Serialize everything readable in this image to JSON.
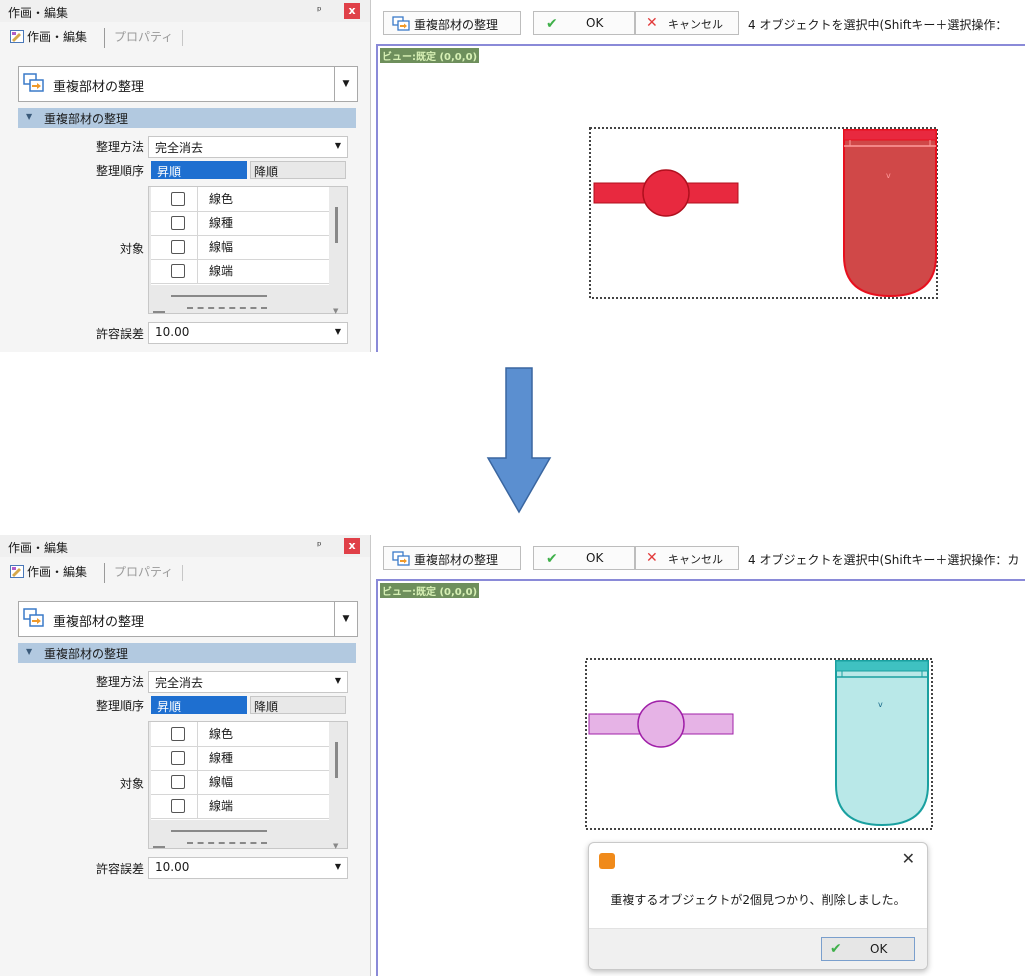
{
  "panel": {
    "title": "作画・編集",
    "pin": "ᵖ",
    "close": "x",
    "tab_active": "作画・編集",
    "tab_inactive": "プロパティ",
    "function_name": "重複部材の整理",
    "group_label": "重複部材の整理",
    "method_label": "整理方法",
    "method_value": "完全消去",
    "order_label": "整理順序",
    "order_asc": "昇順",
    "order_desc": "降順",
    "target_label": "対象",
    "targets": [
      "線色",
      "線種",
      "線幅",
      "線端"
    ],
    "tolerance_label": "許容誤差",
    "tolerance_value": "10.00"
  },
  "toolbar": {
    "function_button": "重複部材の整理",
    "ok_button": "OK",
    "cancel_button": "キャンセル",
    "status_top": "4 オブジェクトを選択中(Shiftキー＋選択操作：",
    "status_bottom": "4 オブジェクトを選択中(Shiftキー＋選択操作：カ"
  },
  "canvas": {
    "view_label": "ビュー:既定 (0,0,0)"
  },
  "dialog": {
    "message": "重複するオブジェクトが2個見つかり、削除しました。",
    "ok_button": "OK",
    "close": "✕"
  },
  "colors": {
    "selected_red": "#e8293f",
    "result_magenta": "#e6b3e6",
    "result_cyan": "#b9e8e8",
    "accent_blue": "#1e6fd0",
    "arrow_blue": "#5b8fd0"
  }
}
